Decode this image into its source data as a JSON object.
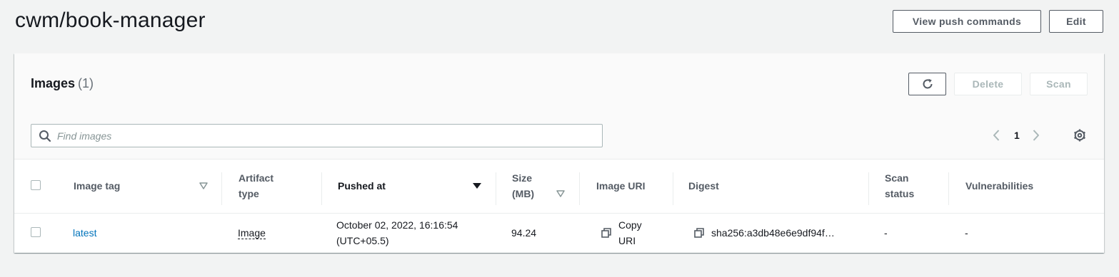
{
  "header": {
    "title": "cwm/book-manager",
    "view_push_label": "View push commands",
    "edit_label": "Edit"
  },
  "images_panel": {
    "title": "Images",
    "count": "(1)",
    "delete_label": "Delete",
    "scan_label": "Scan",
    "search_placeholder": "Find images",
    "page_number": "1"
  },
  "table": {
    "columns": {
      "image_tag": "Image tag",
      "artifact_type_l1": "Artifact",
      "artifact_type_l2": "type",
      "pushed_at": "Pushed at",
      "size_l1": "Size",
      "size_l2": "(MB)",
      "image_uri": "Image URI",
      "digest": "Digest",
      "scan_status_l1": "Scan",
      "scan_status_l2": "status",
      "vulnerabilities": "Vulnerabilities"
    },
    "rows": [
      {
        "image_tag": "latest",
        "artifact_type": "Image",
        "pushed_at_l1": "October 02, 2022, 16:16:54",
        "pushed_at_l2": "(UTC+05.5)",
        "size": "94.24",
        "copy_uri_l1": "Copy",
        "copy_uri_l2": "URI",
        "digest": "sha256:a3db48e6e9df94f…",
        "scan_status": "-",
        "vulnerabilities": "-"
      }
    ]
  },
  "icons": {
    "refresh": "refresh-icon",
    "search": "search-icon",
    "settings": "gear-icon",
    "copy": "copy-icon",
    "prev": "chevron-left-icon",
    "next": "chevron-right-icon",
    "sort": "sort-caret-icon"
  },
  "colors": {
    "link": "#0073bb",
    "button_border": "#545b64",
    "disabled": "#aab7b8",
    "background": "#f2f3f3"
  }
}
